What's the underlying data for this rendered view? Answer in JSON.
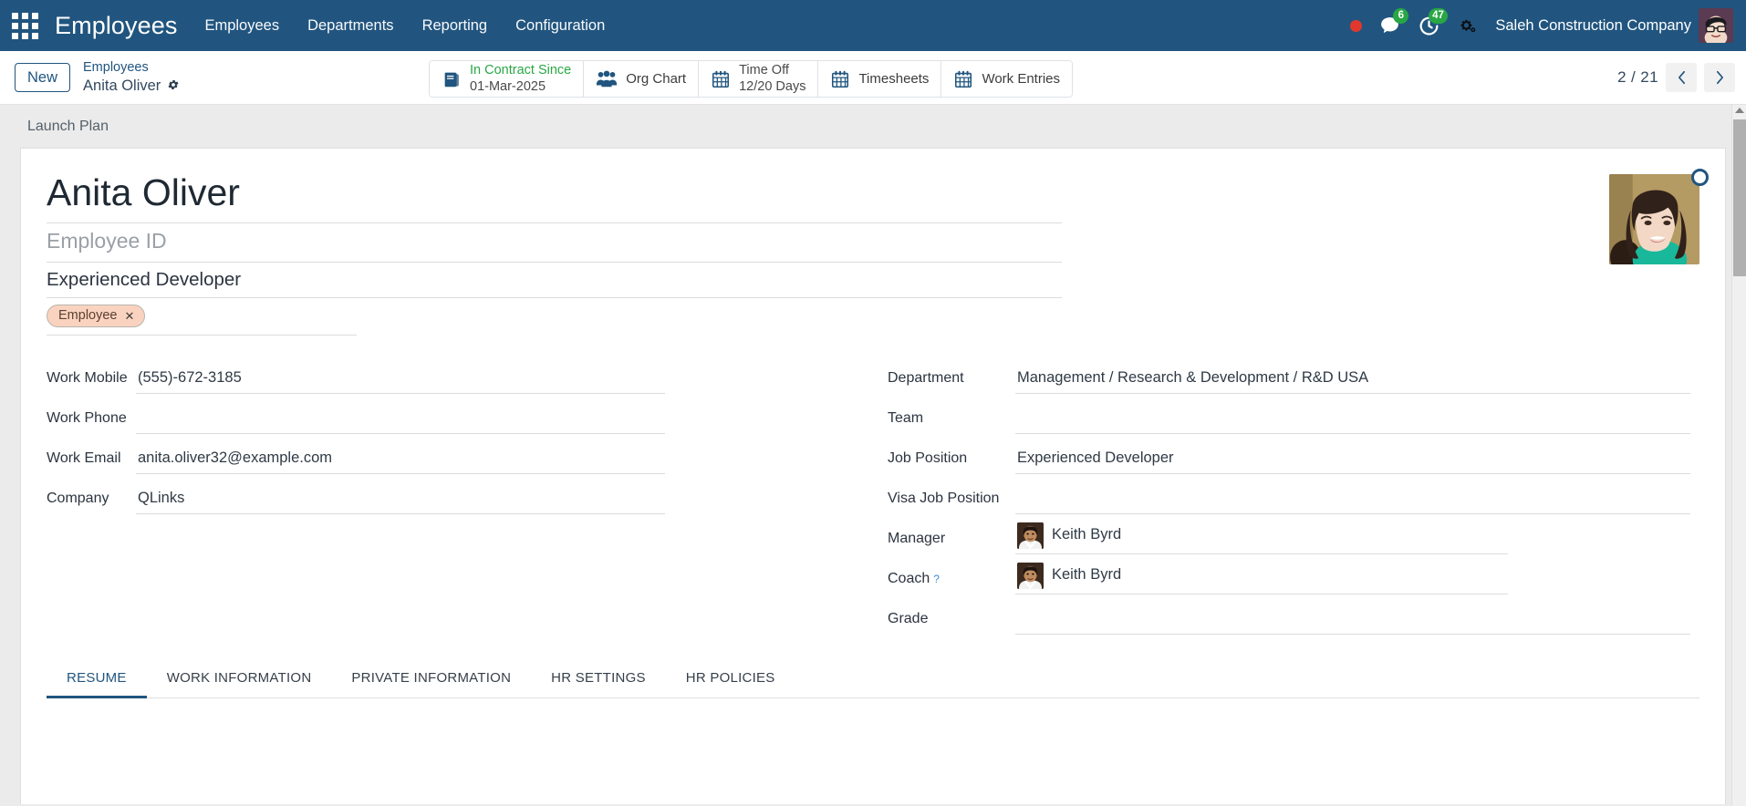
{
  "navbar": {
    "apps_icon": "apps-grid-icon",
    "app_name": "Employees",
    "menu": [
      {
        "label": "Employees"
      },
      {
        "label": "Departments"
      },
      {
        "label": "Reporting"
      },
      {
        "label": "Configuration"
      }
    ],
    "systray": {
      "recording_indicator": "record-dot-icon",
      "messages_icon": "chat-bubble-icon",
      "messages_count": "6",
      "activities_icon": "clock-activity-icon",
      "activities_count": "47",
      "settings_icon": "gears-icon",
      "company_name": "Saleh Construction Company",
      "user_avatar": "user-avatar"
    },
    "accent_color": "#21557f",
    "badge_color": "#28a745",
    "record_dot_color": "#e0382d"
  },
  "control_panel": {
    "new_label": "New",
    "breadcrumb_parent": "Employees",
    "breadcrumb_current": "Anita Oliver",
    "breadcrumb_gear_icon": "gear-icon",
    "stat_buttons": [
      {
        "icon": "contract-book-icon",
        "title": "In Contract Since",
        "subtitle": "01-Mar-2025",
        "title_color": "#28a745",
        "two_line": true
      },
      {
        "icon": "org-chart-people-icon",
        "title": "Org Chart",
        "subtitle": "",
        "two_line": false
      },
      {
        "icon": "calendar-icon",
        "title": "Time Off",
        "subtitle": "12/20 Days",
        "title_color": "#4a4a4a",
        "two_line": true
      },
      {
        "icon": "calendar-icon",
        "title": "Timesheets",
        "subtitle": "",
        "two_line": false
      },
      {
        "icon": "calendar-icon",
        "title": "Work Entries",
        "subtitle": "",
        "two_line": false
      }
    ],
    "pager": {
      "counter": "2 / 21",
      "prev_icon": "chevron-left-icon",
      "next_icon": "chevron-right-icon"
    }
  },
  "statusbar": {
    "items": [
      {
        "label": "Launch Plan"
      }
    ]
  },
  "record": {
    "name": "Anita Oliver",
    "employee_id_placeholder": "Employee ID",
    "employee_id_value": "",
    "job_title": "Experienced Developer",
    "tags": [
      {
        "label": "Employee",
        "remove_icon": "close-icon",
        "bg": "#f9d3bf"
      }
    ],
    "photo_alt": "employee-photo",
    "photo_edit_icon": "edit-photo-icon"
  },
  "fields_left": [
    {
      "label": "Work Mobile",
      "value": "(555)-672-3185",
      "avatar": false
    },
    {
      "label": "Work Phone",
      "value": "",
      "avatar": false
    },
    {
      "label": "Work Email",
      "value": "anita.oliver32@example.com",
      "avatar": false
    },
    {
      "label": "Company",
      "value": "QLinks",
      "avatar": false
    }
  ],
  "fields_right": [
    {
      "label": "Department",
      "value": "Management / Research & Development / R&D USA",
      "avatar": false,
      "help": false
    },
    {
      "label": "Team",
      "value": "",
      "avatar": false,
      "help": false
    },
    {
      "label": "Job Position",
      "value": "Experienced Developer",
      "avatar": false,
      "help": false
    },
    {
      "label": "Visa Job Position",
      "value": "",
      "avatar": false,
      "help": false
    },
    {
      "label": "Manager",
      "value": "Keith Byrd",
      "avatar": true,
      "help": false
    },
    {
      "label": "Coach",
      "value": "Keith Byrd",
      "avatar": true,
      "help": true,
      "help_glyph": "?"
    },
    {
      "label": "Grade",
      "value": "",
      "avatar": false,
      "help": false
    }
  ],
  "notebook": {
    "tabs": [
      {
        "label": "Resume",
        "active": true
      },
      {
        "label": "Work Information",
        "active": false
      },
      {
        "label": "Private Information",
        "active": false
      },
      {
        "label": "HR Settings",
        "active": false
      },
      {
        "label": "HR Policies",
        "active": false
      }
    ]
  },
  "scrollbar": {
    "up_arrow_icon": "scroll-up-arrow-icon",
    "thumb": "scrollbar-thumb"
  }
}
